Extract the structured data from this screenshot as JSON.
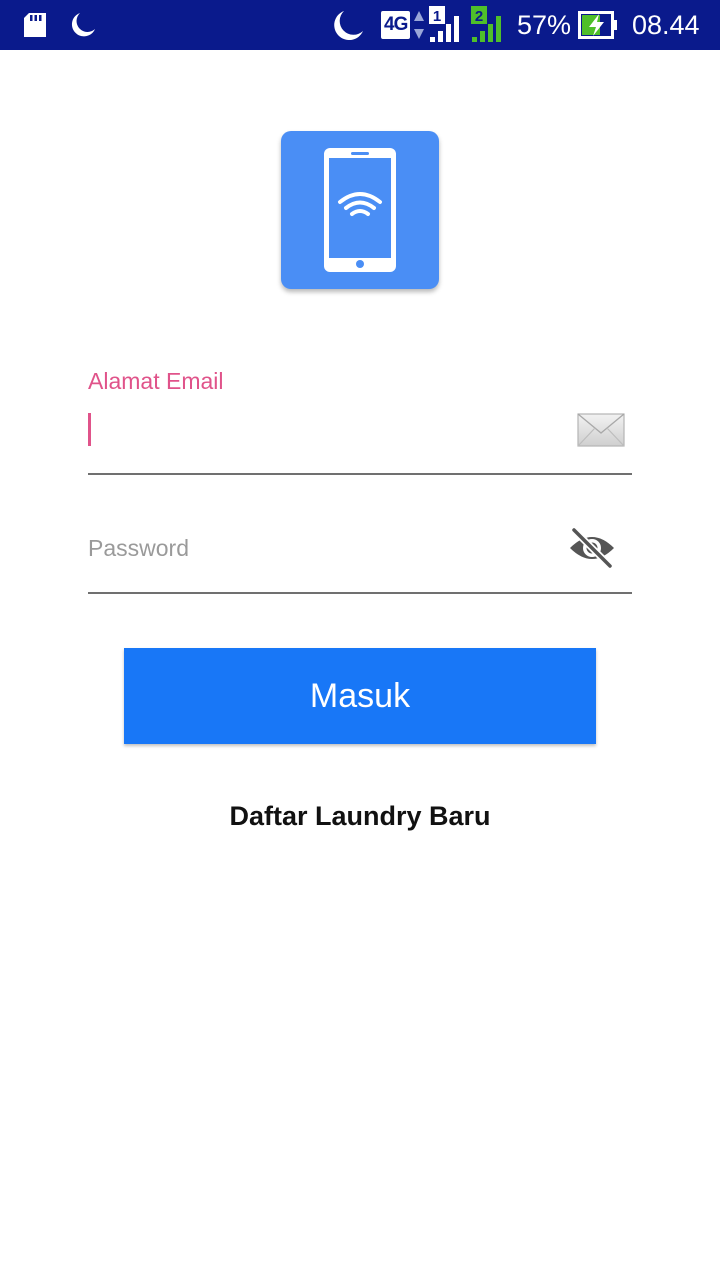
{
  "status_bar": {
    "network_type": "4G",
    "sim1_label": "1",
    "sim2_label": "2",
    "battery_percent": "57%",
    "time": "08.44",
    "icons": [
      "sd-card-icon",
      "moon-icon",
      "data-arrows-icon",
      "signal-icon",
      "battery-charging-icon"
    ],
    "background_color": "#0a1a8c"
  },
  "logo": {
    "icon": "phone-wifi-icon",
    "color": "#4a8ef5"
  },
  "form": {
    "email_label": "Alamat Email",
    "email_value": "",
    "email_icon": "mail-icon",
    "password_placeholder": "Password",
    "password_value": "",
    "password_icon": "eye-off-icon",
    "accent_color": "#e0538a"
  },
  "login_button": {
    "label": "Masuk",
    "color": "#1877f7"
  },
  "register_link": {
    "label": "Daftar Laundry Baru"
  }
}
